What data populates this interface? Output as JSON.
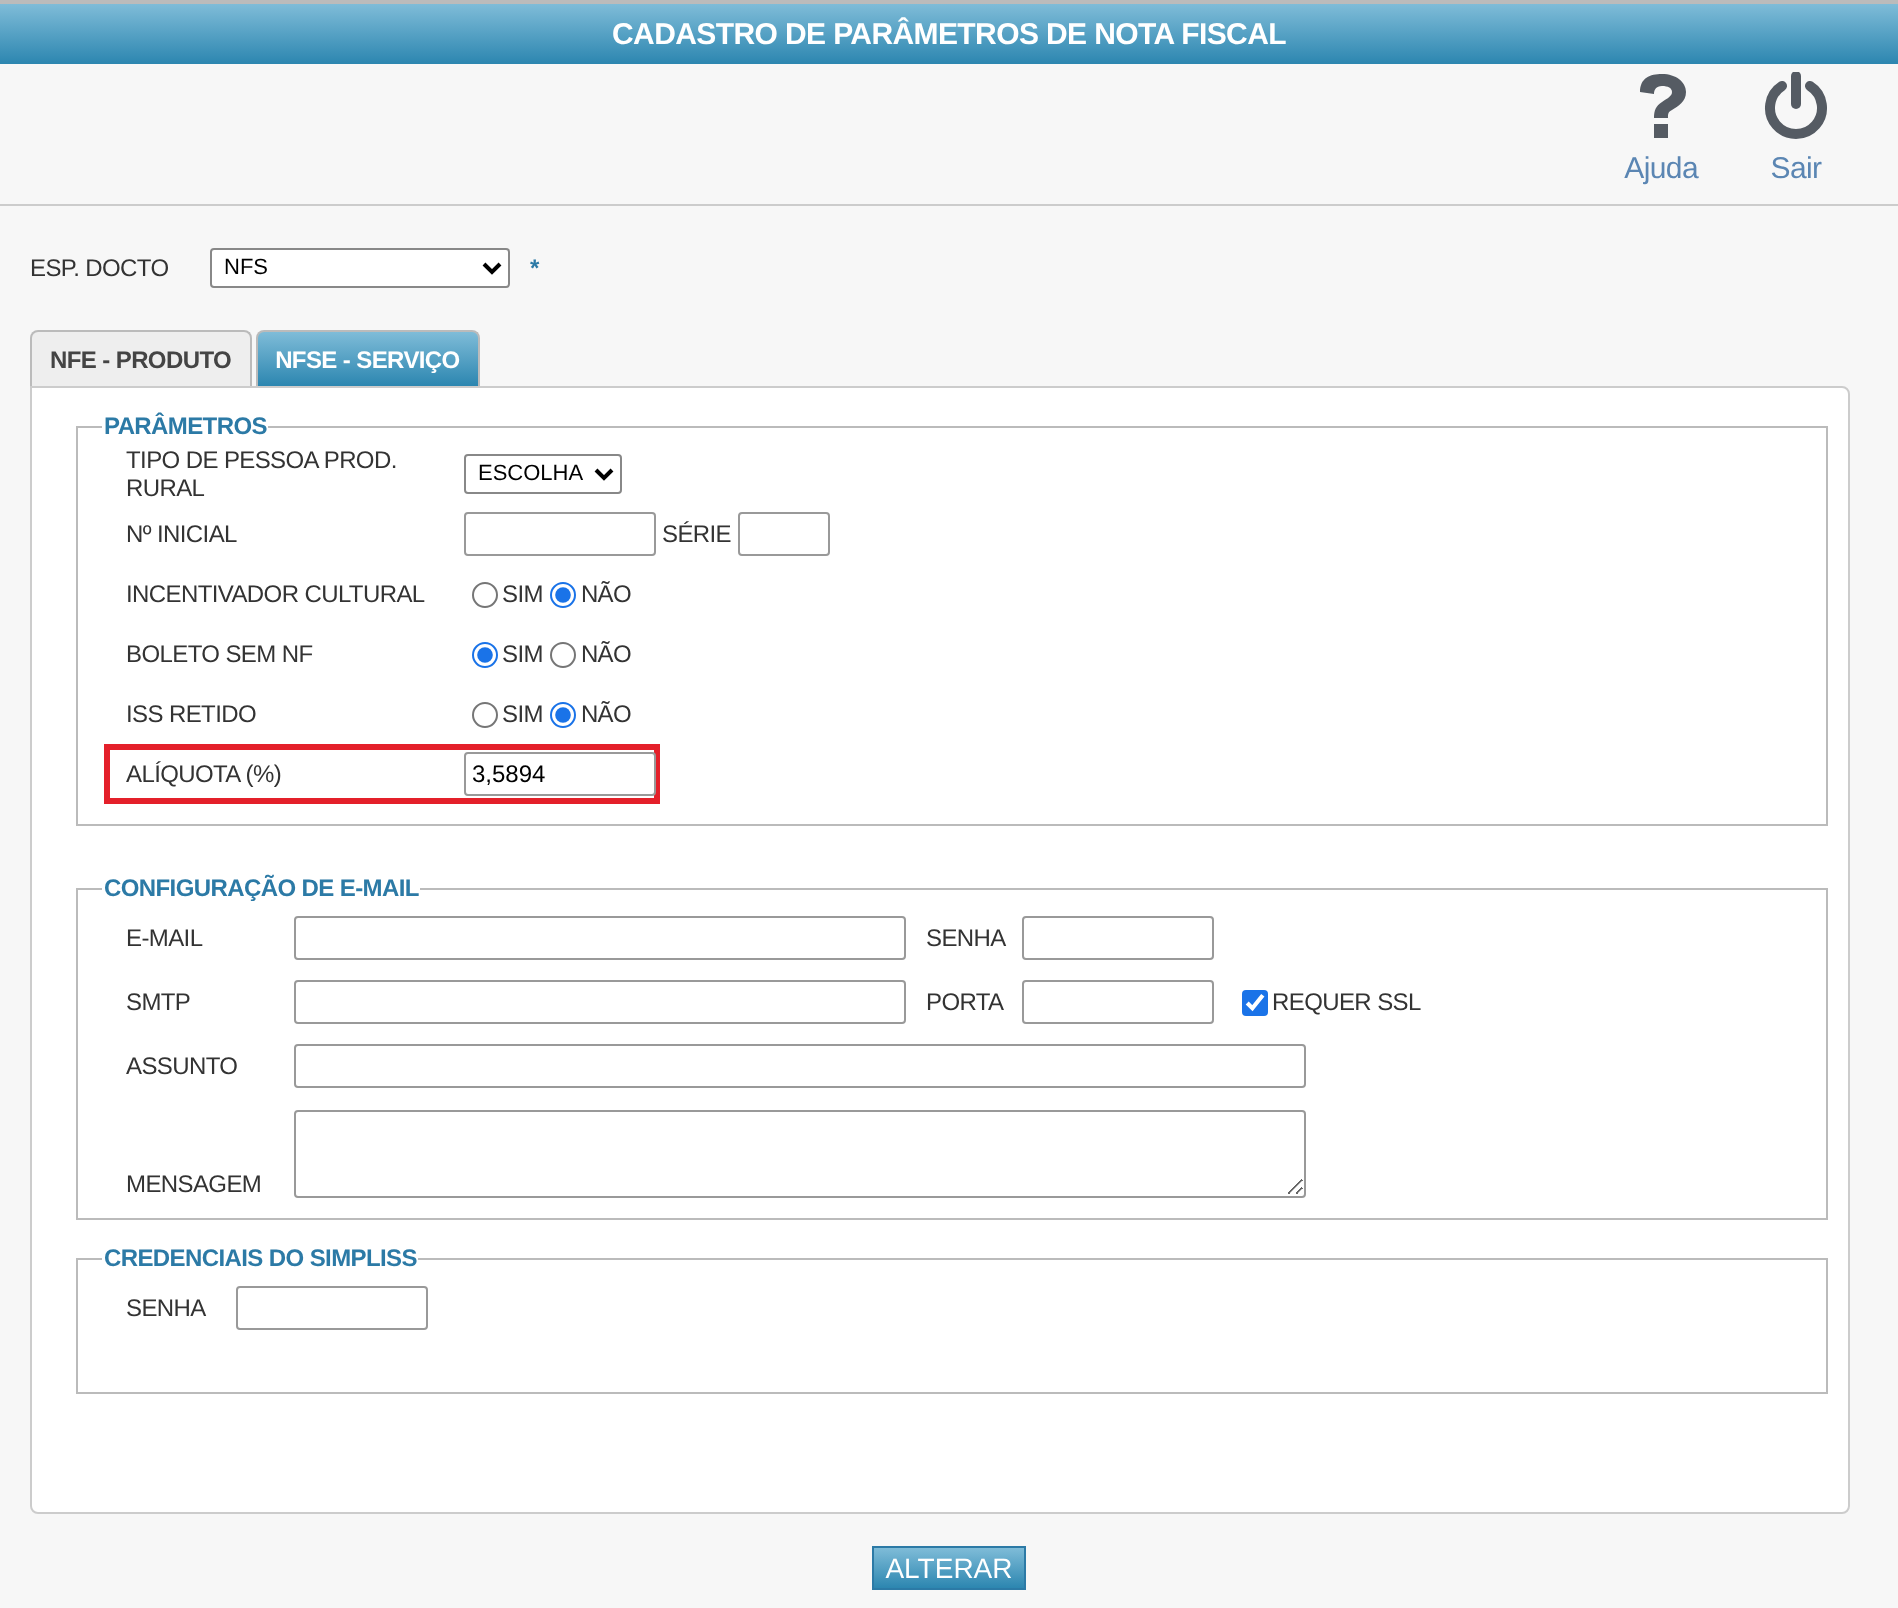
{
  "header": {
    "title": "CADASTRO DE PARÂMETROS DE NOTA FISCAL"
  },
  "toolbar": [
    {
      "kind": "help",
      "label": "Ajuda"
    },
    {
      "kind": "exit",
      "label": "Sair"
    }
  ],
  "esp_docto": {
    "label": "ESP. DOCTO",
    "value": "NFS",
    "required_mark": "*"
  },
  "tabs": [
    {
      "label": "NFE - PRODUTO",
      "selected": false
    },
    {
      "label": "NFSE - SERVIÇO",
      "selected": true
    }
  ],
  "parametros": {
    "legend": "PARÂMETROS",
    "rows": [
      {
        "kind": "select",
        "label": "TIPO DE PESSOA PROD. RURAL",
        "value": "ESCOLHA",
        "highlighted": false
      },
      {
        "kind": "pair",
        "label": "Nº INICIAL",
        "second_label": "SÉRIE",
        "highlighted": false
      },
      {
        "kind": "radio",
        "label": "INCENTIVADOR CULTURAL",
        "highlighted": false,
        "options": [
          {
            "label": "SIM",
            "selected": false
          },
          {
            "label": "NÃO",
            "selected": true
          }
        ]
      },
      {
        "kind": "radio",
        "label": "BOLETO SEM NF",
        "highlighted": false,
        "options": [
          {
            "label": "SIM",
            "selected": true
          },
          {
            "label": "NÃO",
            "selected": false
          }
        ]
      },
      {
        "kind": "radio",
        "label": "ISS RETIDO",
        "highlighted": false,
        "options": [
          {
            "label": "SIM",
            "selected": false
          },
          {
            "label": "NÃO",
            "selected": true
          }
        ]
      },
      {
        "kind": "text",
        "label": "ALÍQUOTA (%)",
        "value": "3,5894",
        "highlighted": true
      }
    ]
  },
  "email": {
    "legend": "CONFIGURAÇÃO DE E-MAIL",
    "email_label": "E-MAIL",
    "senha_label": "SENHA",
    "smtp_label": "SMTP",
    "porta_label": "PORTA",
    "ssl": {
      "label": "REQUER SSL",
      "checked": true
    },
    "assunto_label": "ASSUNTO",
    "mensagem_label": "MENSAGEM"
  },
  "simpliss": {
    "legend": "CREDENCIAIS DO SIMPLISS",
    "senha_label": "SENHA"
  },
  "submit": {
    "label": "ALTERAR"
  }
}
